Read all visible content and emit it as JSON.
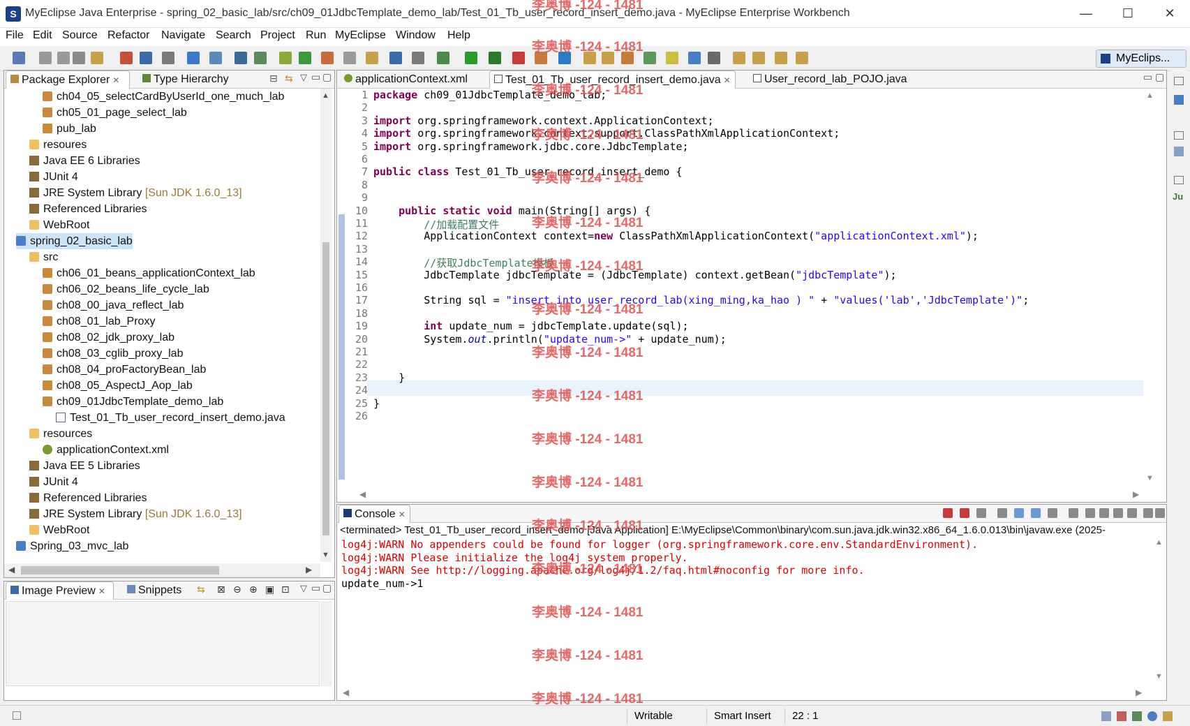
{
  "window": {
    "title": "MyEclipse Java Enterprise - spring_02_basic_lab/src/ch09_01JdbcTemplate_demo_lab/Test_01_Tb_user_record_insert_demo.java - MyEclipse Enterprise Workbench",
    "minimize": "—",
    "maximize": "☐",
    "close": "✕"
  },
  "menu": [
    "File",
    "Edit",
    "Source",
    "Refactor",
    "Navigate",
    "Search",
    "Project",
    "Run",
    "MyEclipse",
    "Window",
    "Help"
  ],
  "perspective": "MyEclips...",
  "package_explorer": {
    "tabs": [
      "Package Explorer",
      "Type Hierarchy"
    ],
    "rows": [
      {
        "label": "ch04_05_selectCardByUserId_one_much_lab",
        "icon": "package-icon",
        "indent": 3
      },
      {
        "label": "ch05_01_page_select_lab",
        "icon": "package-icon",
        "indent": 3
      },
      {
        "label": "pub_lab",
        "icon": "package-icon",
        "indent": 3
      },
      {
        "label": "resoures",
        "icon": "source-folder-icon",
        "indent": 2
      },
      {
        "label": "Java EE 6 Libraries",
        "icon": "library-icon",
        "indent": 2
      },
      {
        "label": "JUnit 4",
        "icon": "library-icon",
        "indent": 2
      },
      {
        "label": "JRE System Library",
        "decor": "[Sun JDK 1.6.0_13]",
        "icon": "library-icon",
        "indent": 2
      },
      {
        "label": "Referenced Libraries",
        "icon": "library-icon",
        "indent": 2
      },
      {
        "label": "WebRoot",
        "icon": "folder-icon",
        "indent": 2
      },
      {
        "label": "spring_02_basic_lab",
        "icon": "project-icon",
        "indent": 1,
        "selected": true
      },
      {
        "label": "src",
        "icon": "source-folder-icon",
        "indent": 2
      },
      {
        "label": "ch06_01_beans_applicationContext_lab",
        "icon": "package-icon",
        "indent": 3
      },
      {
        "label": "ch06_02_beans_life_cycle_lab",
        "icon": "package-icon",
        "indent": 3
      },
      {
        "label": "ch08_00_java_reflect_lab",
        "icon": "package-icon",
        "indent": 3
      },
      {
        "label": "ch08_01_lab_Proxy",
        "icon": "package-icon",
        "indent": 3
      },
      {
        "label": "ch08_02_jdk_proxy_lab",
        "icon": "package-icon",
        "indent": 3
      },
      {
        "label": "ch08_03_cglib_proxy_lab",
        "icon": "package-icon",
        "indent": 3
      },
      {
        "label": "ch08_04_proFactoryBean_lab",
        "icon": "package-icon",
        "indent": 3
      },
      {
        "label": "ch08_05_AspectJ_Aop_lab",
        "icon": "package-icon",
        "indent": 3
      },
      {
        "label": "ch09_01JdbcTemplate_demo_lab",
        "icon": "package-icon",
        "indent": 3
      },
      {
        "label": "Test_01_Tb_user_record_insert_demo.java",
        "icon": "java-file-icon",
        "indent": 4
      },
      {
        "label": "resources",
        "icon": "source-folder-icon",
        "indent": 2
      },
      {
        "label": "applicationContext.xml",
        "icon": "xml-file-icon",
        "indent": 3
      },
      {
        "label": "Java EE 5 Libraries",
        "icon": "library-icon",
        "indent": 2
      },
      {
        "label": "JUnit 4",
        "icon": "library-icon",
        "indent": 2
      },
      {
        "label": "Referenced Libraries",
        "icon": "library-icon",
        "indent": 2
      },
      {
        "label": "JRE System Library",
        "decor": "[Sun JDK 1.6.0_13]",
        "icon": "library-icon",
        "indent": 2
      },
      {
        "label": "WebRoot",
        "icon": "folder-icon",
        "indent": 2
      },
      {
        "label": "Spring_03_mvc_lab",
        "icon": "project-icon",
        "indent": 1
      }
    ]
  },
  "image_preview": {
    "tabs": [
      "Image Preview",
      "Snippets"
    ]
  },
  "editor": {
    "tabs": [
      "applicationContext.xml",
      "Test_01_Tb_user_record_insert_demo.java",
      "User_record_lab_POJO.java"
    ],
    "lines": [
      "package ch09_01JdbcTemplate_demo_lab;",
      "",
      "import org.springframework.context.ApplicationContext;",
      "import org.springframework.context.support.ClassPathXmlApplicationContext;",
      "import org.springframework.jdbc.core.JdbcTemplate;",
      "",
      "public class Test_01_Tb_user_record_insert_demo {",
      "",
      "",
      "    public static void main(String[] args) {",
      "        //加载配置文件",
      "        ApplicationContext context=new ClassPathXmlApplicationContext(\"applicationContext.xml\");",
      "",
      "        //获取JdbcTemplate模板",
      "        JdbcTemplate jdbcTemplate = (JdbcTemplate) context.getBean(\"jdbcTemplate\");",
      "",
      "        String sql = \"insert into user_record_lab(xing_ming,ka_hao ) \" + \"values('lab','JdbcTemplate')\";",
      "",
      "        int update_num = jdbcTemplate.update(sql);",
      "        System.out.println(\"update_num->\" + update_num);",
      "",
      "",
      "    }",
      "",
      "}",
      ""
    ]
  },
  "console": {
    "tab": "Console",
    "header": "<terminated> Test_01_Tb_user_record_insert_demo [Java Application] E:\\MyEclipse\\Common\\binary\\com.sun.java.jdk.win32.x86_64_1.6.0.013\\bin\\javaw.exe (2025-",
    "lines": [
      {
        "text": "log4j:WARN No appenders could be found for logger (org.springframework.core.env.StandardEnvironment).",
        "level": "warn"
      },
      {
        "text": "log4j:WARN Please initialize the log4j system properly.",
        "level": "warn"
      },
      {
        "text": "log4j:WARN See http://logging.apache.org/log4j/1.2/faq.html#noconfig for more info.",
        "level": "warn"
      },
      {
        "text": "update_num->1",
        "level": "out"
      }
    ]
  },
  "statusbar": {
    "writable": "Writable",
    "insert_mode": "Smart Insert",
    "position": "22 : 1"
  },
  "watermark": "李奥博 -124 - 1481",
  "colors": {
    "keyword": "#7f0055",
    "string": "#2a00ff",
    "comment": "#3f7f5f",
    "warn": "#dd0000",
    "watermark": "#e05050"
  }
}
